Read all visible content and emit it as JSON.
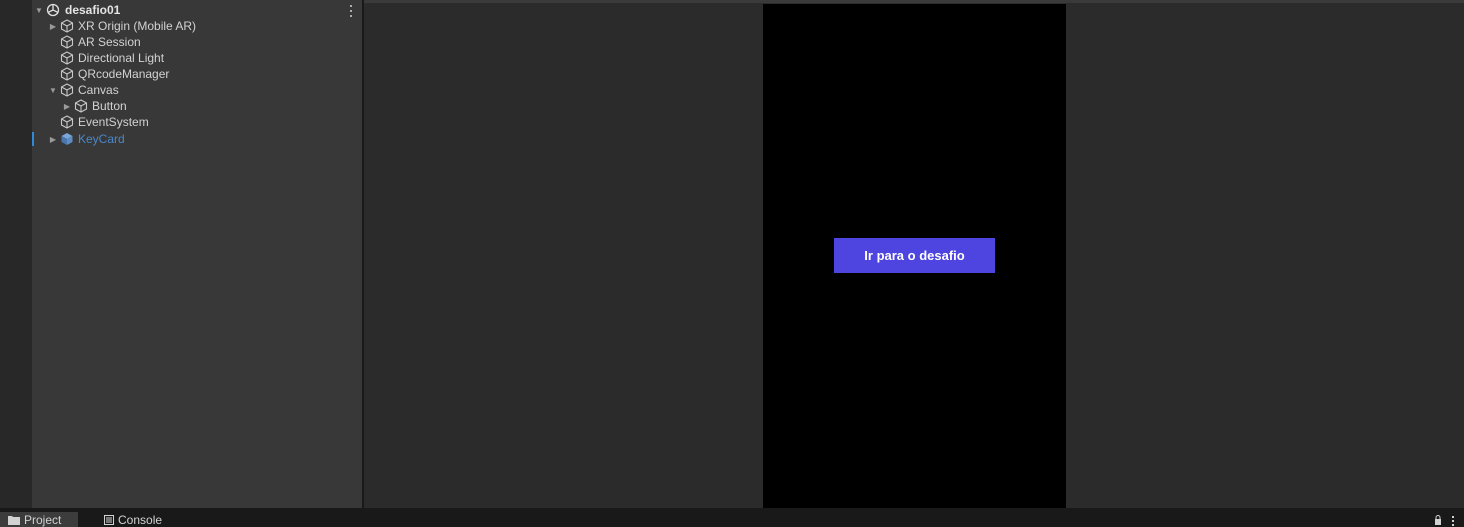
{
  "hierarchy": {
    "scene": {
      "name": "desafio01"
    },
    "items": [
      {
        "label": "XR Origin (Mobile AR)",
        "has_children": true,
        "expanded": false,
        "depth": 1
      },
      {
        "label": "AR Session",
        "has_children": false,
        "depth": 1
      },
      {
        "label": "Directional Light",
        "has_children": false,
        "depth": 1
      },
      {
        "label": "QRcodeManager",
        "has_children": false,
        "depth": 1
      },
      {
        "label": "Canvas",
        "has_children": true,
        "expanded": true,
        "depth": 1
      },
      {
        "label": "Button",
        "has_children": true,
        "expanded": false,
        "depth": 2
      },
      {
        "label": "EventSystem",
        "has_children": false,
        "depth": 1
      },
      {
        "label": "KeyCard",
        "has_children": true,
        "expanded": false,
        "depth": 1,
        "prefab": true,
        "selected": true
      }
    ]
  },
  "game_view": {
    "button_label": "Ir para o desafio",
    "button_color": "#4e44e0"
  },
  "bottom_tabs": {
    "project": "Project",
    "console": "Console"
  },
  "colors": {
    "prefab_text": "#4a87c9",
    "selection_accent": "#2f8bd8"
  }
}
